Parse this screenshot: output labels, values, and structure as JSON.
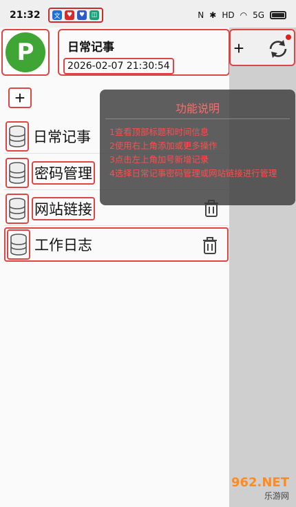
{
  "statusbar": {
    "time": "21:32",
    "notif_icons": [
      "app-icon-1",
      "app-icon-2",
      "app-icon-3",
      "app-icon-4"
    ],
    "right_icons": [
      "nfc-icon",
      "bluetooth-icon",
      "hd-icon",
      "wifi-icon",
      "5g-signal-icon",
      "battery-icon"
    ],
    "hd_label": "HD",
    "net_label": "5G"
  },
  "header": {
    "title": "日常记事",
    "datetime": "2026-02-07 21:30:54",
    "logo_letter": "P"
  },
  "toolbar": {
    "add_label": "+",
    "sidebar_add_label": "+"
  },
  "items": [
    {
      "label": "日常记事",
      "has_trash": false
    },
    {
      "label": "密码管理",
      "has_trash": false
    },
    {
      "label": "网站链接",
      "has_trash": true
    },
    {
      "label": "工作日志",
      "has_trash": true
    }
  ],
  "dialog": {
    "title": "功能说明",
    "lines": [
      "1查看顶部标题和时间信息",
      "2使用右上角添加或更多操作",
      "3点击左上角加号新增记录",
      "4选择日常记事密码管理或网站链接进行管理"
    ]
  },
  "watermark": {
    "top": "962.NET",
    "bottom": "乐游网"
  },
  "colors": {
    "annotation_red": "#dd4444",
    "logo_green": "#3fa535",
    "dialog_text": "#ff4d4d"
  }
}
